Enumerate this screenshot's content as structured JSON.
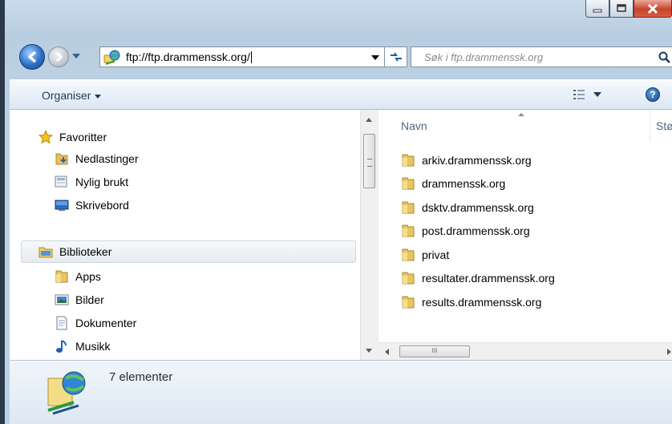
{
  "window": {
    "title_buttons": [
      "minimize",
      "maximize",
      "close"
    ]
  },
  "address_bar": {
    "value": "ftp://ftp.drammenssk.org/"
  },
  "search": {
    "placeholder": "Søk i ftp.drammenssk.org"
  },
  "toolbar": {
    "organise_label": "Organiser"
  },
  "nav_pane": {
    "favorites": {
      "label": "Favoritter",
      "items": [
        {
          "label": "Nedlastinger",
          "icon": "downloads-folder-icon"
        },
        {
          "label": "Nylig brukt",
          "icon": "recent-places-icon"
        },
        {
          "label": "Skrivebord",
          "icon": "desktop-icon"
        }
      ]
    },
    "libraries": {
      "label": "Biblioteker",
      "items": [
        {
          "label": "Apps",
          "icon": "folder-icon"
        },
        {
          "label": "Bilder",
          "icon": "pictures-icon"
        },
        {
          "label": "Dokumenter",
          "icon": "documents-icon"
        },
        {
          "label": "Musikk",
          "icon": "music-icon"
        }
      ]
    }
  },
  "content": {
    "columns": [
      "Navn",
      "Stør"
    ],
    "files": [
      "arkiv.drammenssk.org",
      "drammenssk.org",
      "dsktv.drammenssk.org",
      "post.drammenssk.org",
      "privat",
      "resultater.drammenssk.org",
      "results.drammenssk.org"
    ]
  },
  "status_bar": {
    "text": "7 elementer"
  },
  "hscroll": {
    "thumb_grip": "III"
  }
}
